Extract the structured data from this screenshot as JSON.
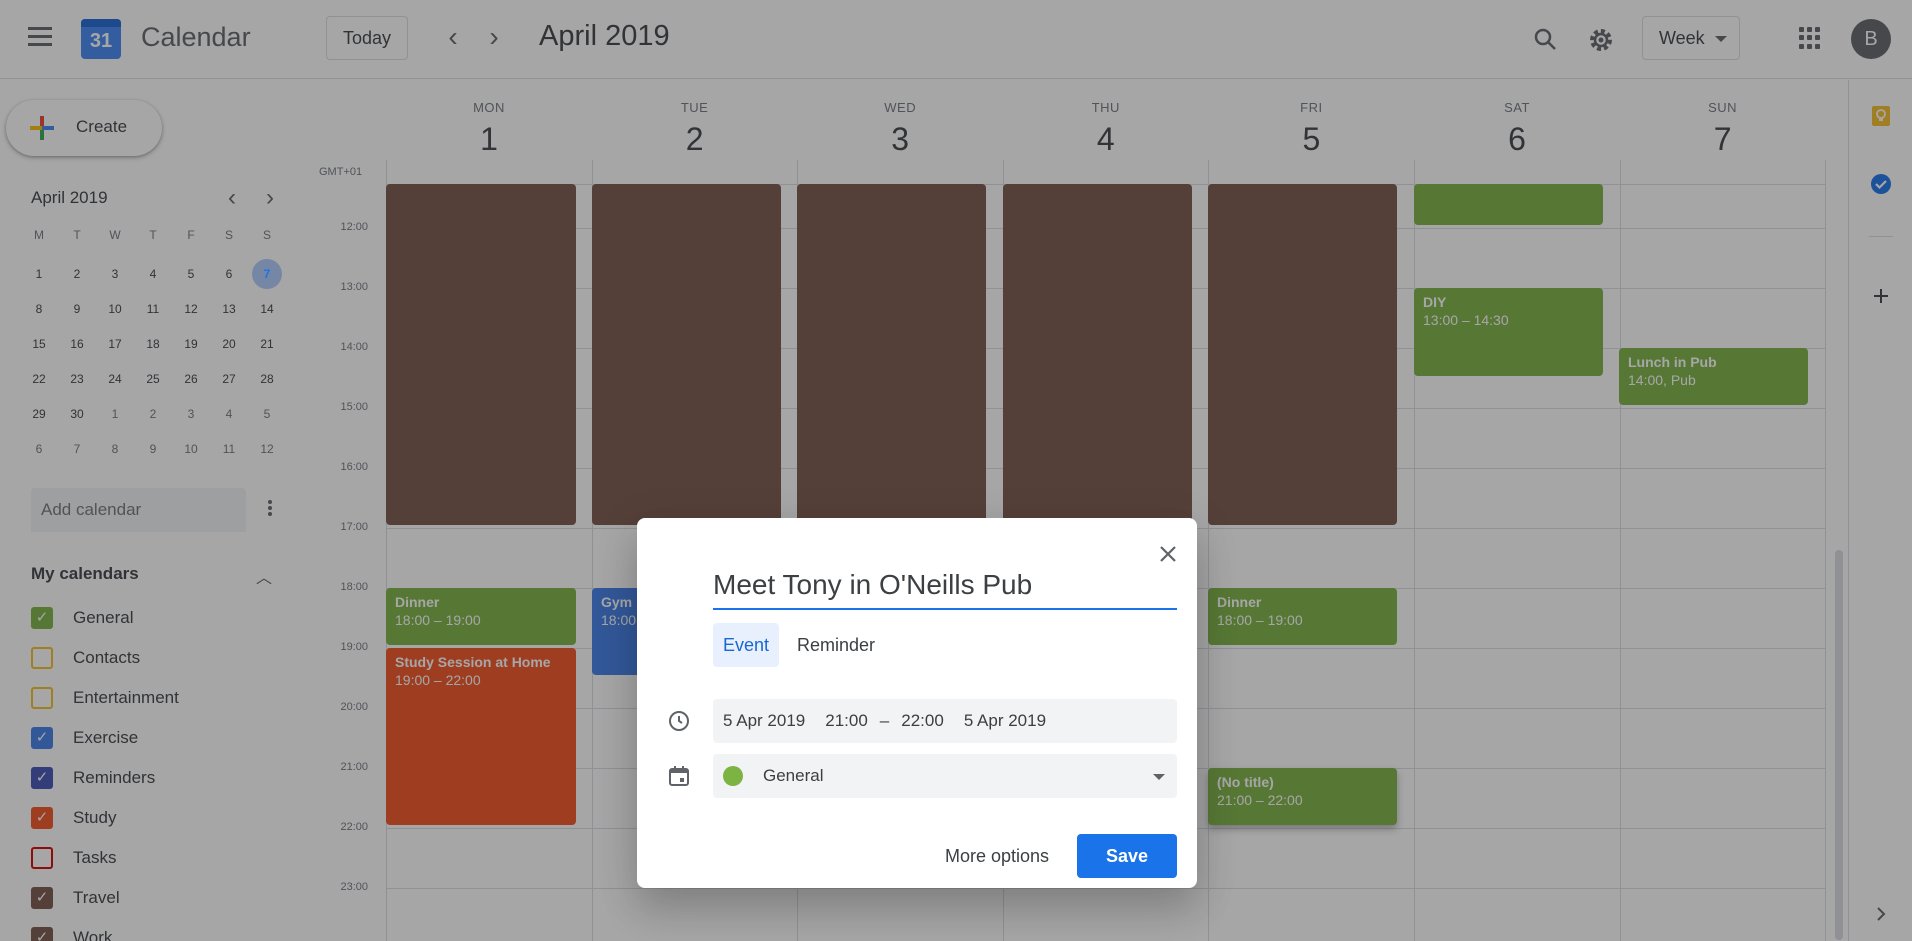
{
  "header": {
    "app_title": "Calendar",
    "logo_day": "31",
    "today_label": "Today",
    "month_title": "April 2019",
    "view_label": "Week",
    "avatar_initial": "B"
  },
  "sidebar": {
    "create_label": "Create",
    "mini_month": "April 2019",
    "mini_dow": [
      "M",
      "T",
      "W",
      "T",
      "F",
      "S",
      "S"
    ],
    "mini_weeks": [
      [
        "1",
        "2",
        "3",
        "4",
        "5",
        "6",
        "7"
      ],
      [
        "8",
        "9",
        "10",
        "11",
        "12",
        "13",
        "14"
      ],
      [
        "15",
        "16",
        "17",
        "18",
        "19",
        "20",
        "21"
      ],
      [
        "22",
        "23",
        "24",
        "25",
        "26",
        "27",
        "28"
      ],
      [
        "29",
        "30",
        "1",
        "2",
        "3",
        "4",
        "5"
      ],
      [
        "6",
        "7",
        "8",
        "9",
        "10",
        "11",
        "12"
      ]
    ],
    "add_calendar_placeholder": "Add calendar",
    "my_calendars_title": "My calendars",
    "calendars": [
      {
        "label": "General",
        "color": "#7cb342",
        "checked": true
      },
      {
        "label": "Contacts",
        "color": "#f6bf26",
        "checked": false
      },
      {
        "label": "Entertainment",
        "color": "#f6bf26",
        "checked": false
      },
      {
        "label": "Exercise",
        "color": "#3f7de8",
        "checked": true
      },
      {
        "label": "Reminders",
        "color": "#3f51b5",
        "checked": true
      },
      {
        "label": "Study",
        "color": "#f4511e",
        "checked": true
      },
      {
        "label": "Tasks",
        "color": "#d50000",
        "checked": false
      },
      {
        "label": "Travel",
        "color": "#795548",
        "checked": true
      },
      {
        "label": "Work",
        "color": "#795548",
        "checked": true
      }
    ]
  },
  "grid": {
    "timezone": "GMT+01",
    "days": [
      {
        "dow": "MON",
        "num": "1"
      },
      {
        "dow": "TUE",
        "num": "2"
      },
      {
        "dow": "WED",
        "num": "3"
      },
      {
        "dow": "THU",
        "num": "4"
      },
      {
        "dow": "FRI",
        "num": "5"
      },
      {
        "dow": "SAT",
        "num": "6"
      },
      {
        "dow": "SUN",
        "num": "7"
      }
    ],
    "hours": [
      "12:00",
      "13:00",
      "14:00",
      "15:00",
      "16:00",
      "17:00",
      "18:00",
      "19:00",
      "20:00",
      "21:00",
      "22:00",
      "23:00"
    ],
    "events": [
      {
        "title": "DIY",
        "time": "13:00 – 14:30",
        "color": "#7cb342"
      },
      {
        "title": "Lunch in Pub",
        "time": "14:00, Pub",
        "color": "#7cb342"
      },
      {
        "title": "Dinner",
        "time": "18:00 – 19:00",
        "color": "#7cb342"
      },
      {
        "title": "Gym",
        "time": "18:00",
        "color": "#3f7de8"
      },
      {
        "title": "Dinner",
        "time": "18:00 – 19:00",
        "color": "#7cb342"
      },
      {
        "title": "Study Session at Home",
        "time": "19:00 – 22:00",
        "color": "#f4511e"
      },
      {
        "title": "(No title)",
        "time": "21:00 – 22:00",
        "color": "#7cb342"
      }
    ],
    "work_color": "#795548"
  },
  "dialog": {
    "title_value": "Meet Tony in O'Neills Pub",
    "tab_event": "Event",
    "tab_reminder": "Reminder",
    "start_date": "5 Apr 2019",
    "start_time": "21:00",
    "dash": "–",
    "end_time": "22:00",
    "end_date": "5 Apr 2019",
    "calendar_value": "General",
    "more_options_label": "More options",
    "save_label": "Save",
    "accent": "#1a73e8"
  }
}
